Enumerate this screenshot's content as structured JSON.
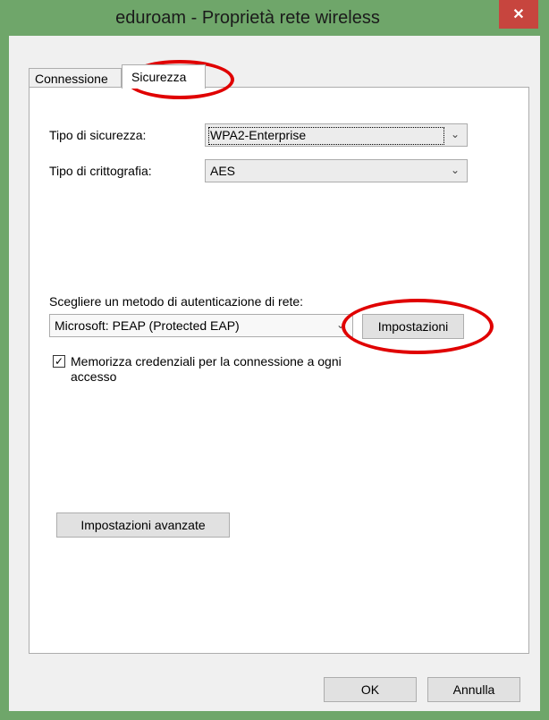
{
  "window": {
    "title": "eduroam - Proprietà rete wireless",
    "close_label": "✕"
  },
  "tabs": [
    {
      "label": "Connessione"
    },
    {
      "label": "Sicurezza"
    }
  ],
  "security": {
    "type_label": "Tipo di sicurezza:",
    "type_value": "WPA2-Enterprise",
    "encryption_label": "Tipo di crittografia:",
    "encryption_value": "AES",
    "auth_method_label": "Scegliere un metodo di autenticazione di rete:",
    "auth_method_value": "Microsoft: PEAP (Protected EAP)",
    "settings_button": "Impostazioni",
    "remember_checkbox_checked": true,
    "remember_checkbox_label_line1": "Memorizza credenziali per la connessione a ogni",
    "remember_checkbox_label_line2": "accesso",
    "advanced_button": "Impostazioni avanzate"
  },
  "footer": {
    "ok_button": "OK",
    "cancel_button": "Annulla"
  },
  "colors": {
    "frame": "#6fa66a",
    "close": "#c7453e",
    "annotation": "#e00000"
  }
}
